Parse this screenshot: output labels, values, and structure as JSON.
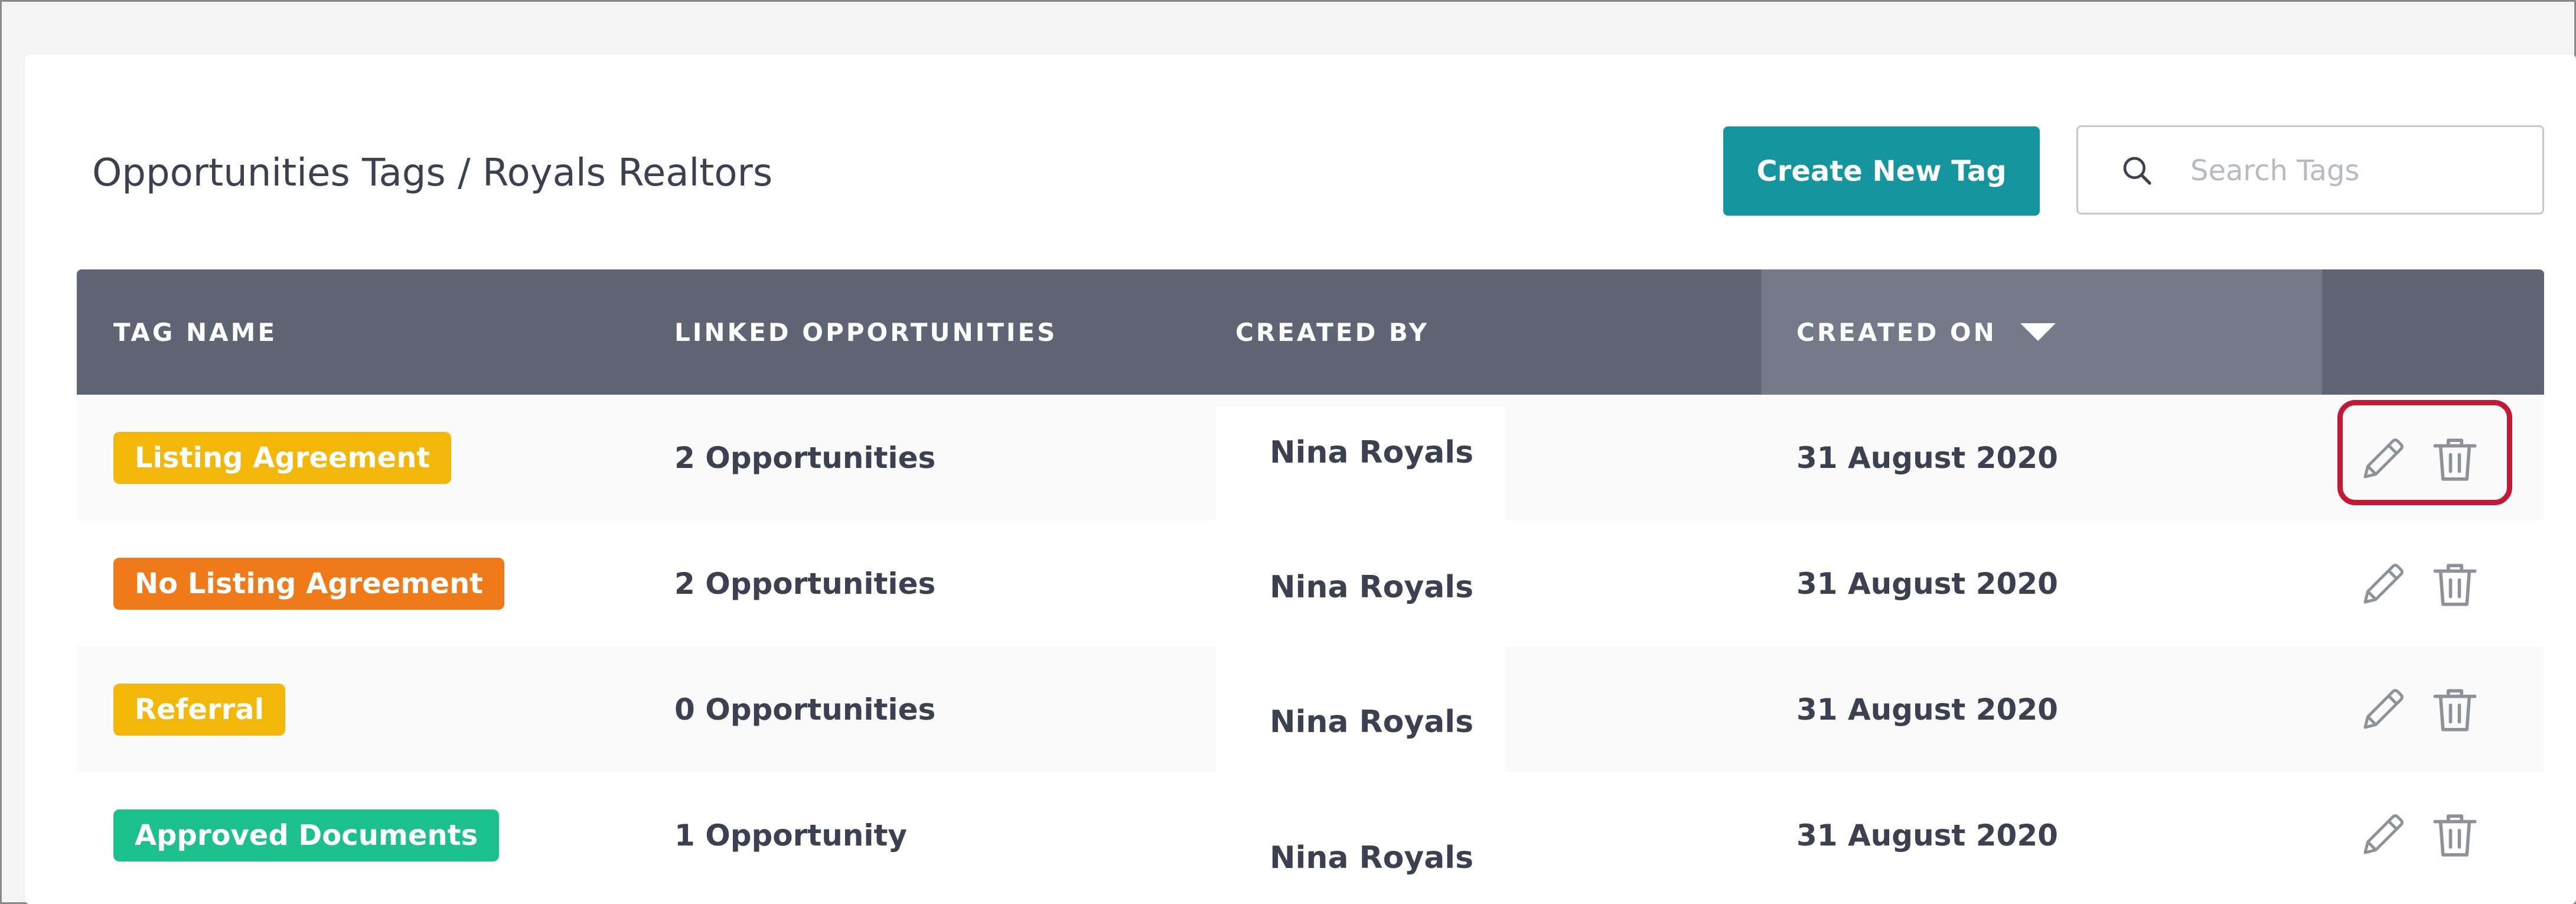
{
  "header": {
    "title": "Opportunities Tags / Royals Realtors",
    "create_button_label": "Create New Tag",
    "search_placeholder": "Search Tags"
  },
  "table": {
    "columns": {
      "tag_name": "TAG NAME",
      "linked": "LINKED OPPORTUNITIES",
      "created_by": "CREATED BY",
      "created_on": "CREATED ON"
    },
    "sorted_column": "CREATED ON",
    "sort_direction": "descending",
    "rows": [
      {
        "tag": "Listing Agreement",
        "tag_color": "#f2b708",
        "linked": "2 Opportunities",
        "created_by": "Nina Royals",
        "created_on": "31 August 2020"
      },
      {
        "tag": "No Listing Agreement",
        "tag_color": "#ef7a19",
        "linked": "2 Opportunities",
        "created_by": "Nina Royals",
        "created_on": "31 August 2020"
      },
      {
        "tag": "Referral",
        "tag_color": "#f2b708",
        "linked": "0 Opportunities",
        "created_by": "Nina Royals",
        "created_on": "31 August 2020"
      },
      {
        "tag": "Approved Documents",
        "tag_color": "#1bc08b",
        "linked": "1 Opportunity",
        "created_by": "Nina Royals",
        "created_on": "31 August 2020"
      }
    ]
  },
  "icons": {
    "search": "search-icon",
    "sort": "caret-down-icon",
    "edit": "pencil-icon",
    "delete": "trash-icon"
  },
  "colors": {
    "accent": "#15959e",
    "header_bg": "#606575",
    "header_sorted_bg": "#757a88",
    "highlight": "#c41935",
    "icon": "#8d9199"
  }
}
